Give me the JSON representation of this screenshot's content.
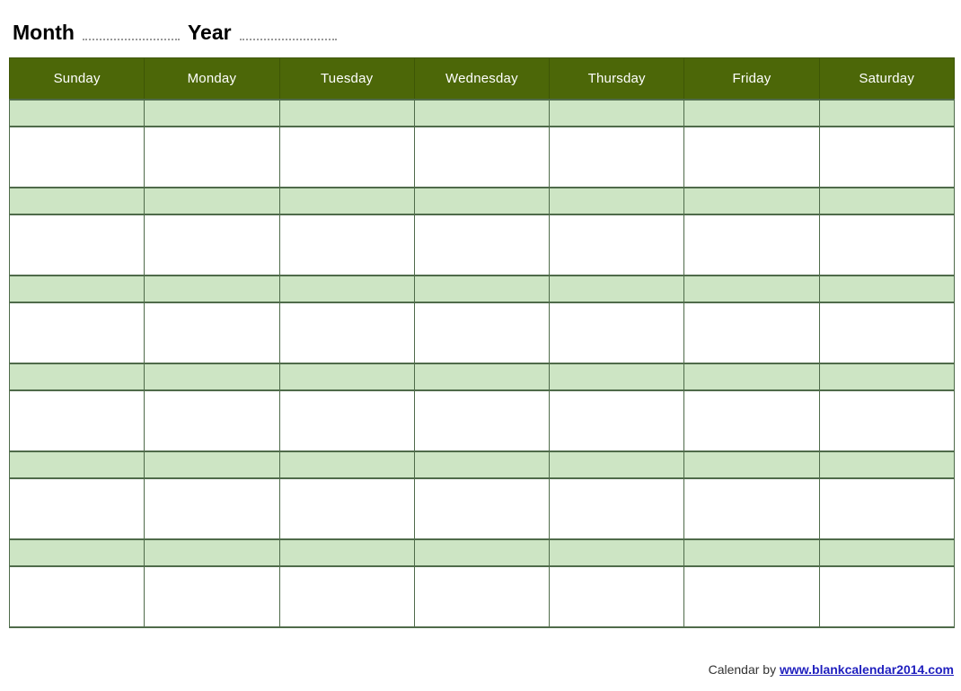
{
  "header": {
    "month_label": "Month",
    "year_label": "Year",
    "month_value": "",
    "year_value": "",
    "month_placeholder": "",
    "year_placeholder": ""
  },
  "calendar": {
    "day_headers": [
      "Sunday",
      "Monday",
      "Tuesday",
      "Wednesday",
      "Thursday",
      "Friday",
      "Saturday"
    ],
    "weeks": [
      {
        "dates": [
          "",
          "",
          "",
          "",
          "",
          "",
          ""
        ],
        "notes": [
          "",
          "",
          "",
          "",
          "",
          "",
          ""
        ]
      },
      {
        "dates": [
          "",
          "",
          "",
          "",
          "",
          "",
          ""
        ],
        "notes": [
          "",
          "",
          "",
          "",
          "",
          "",
          ""
        ]
      },
      {
        "dates": [
          "",
          "",
          "",
          "",
          "",
          "",
          ""
        ],
        "notes": [
          "",
          "",
          "",
          "",
          "",
          "",
          ""
        ]
      },
      {
        "dates": [
          "",
          "",
          "",
          "",
          "",
          "",
          ""
        ],
        "notes": [
          "",
          "",
          "",
          "",
          "",
          "",
          ""
        ]
      },
      {
        "dates": [
          "",
          "",
          "",
          "",
          "",
          "",
          ""
        ],
        "notes": [
          "",
          "",
          "",
          "",
          "",
          "",
          ""
        ]
      },
      {
        "dates": [
          "",
          "",
          "",
          "",
          "",
          "",
          ""
        ],
        "notes": [
          "",
          "",
          "",
          "",
          "",
          "",
          ""
        ]
      }
    ]
  },
  "footer": {
    "credit_text": "Calendar by",
    "credit_link": "www.blankcalendar2014.com"
  },
  "colors": {
    "header_green": "#4c6708",
    "band_green": "#cde5c4",
    "border_green": "#4f6b4a",
    "header_text": "#ffffff",
    "link_blue": "#1f1fbe",
    "dotted_line": "#9a9a9a"
  }
}
